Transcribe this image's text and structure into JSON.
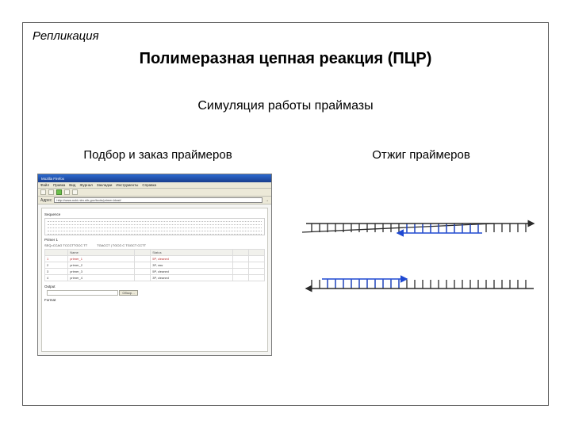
{
  "topic": "Репликация",
  "title": "Полимеразная цепная реакция (ПЦР)",
  "subtitle": "Симуляция работы праймазы",
  "captions": {
    "left": "Подбор и заказ праймеров",
    "right": "Отжиг праймеров"
  },
  "browser": {
    "window_title": "Mozilla Firefox",
    "menu": [
      "Файл",
      "Правка",
      "Вид",
      "Журнал",
      "Закладки",
      "Инструменты",
      "Справка"
    ],
    "address_label": "Адрес",
    "address_url": "http://www.ncbi.nlm.nih.gov/tools/primer-blast/",
    "go": "→"
  },
  "page": {
    "seq_section": "Sequence",
    "primer_section": "Primer 1",
    "primer_subinfo": {
      "col_a": "SEQ=CCAG TCCCTTGCC TT",
      "col_b": "TGACCT | TGCG C TGGCT CCTT"
    },
    "table": {
      "headers": [
        "",
        "Name",
        "",
        "Status",
        "",
        ""
      ],
      "rows": [
        [
          "1",
          "primer_1",
          "",
          "5P, cleaned",
          "",
          ""
        ],
        [
          "2",
          "primer_2",
          "",
          "3P, raw",
          "",
          ""
        ],
        [
          "3",
          "primer_3",
          "",
          "5P, cleaned",
          "",
          ""
        ],
        [
          "4",
          "primer_4",
          "",
          "3P, cleaned",
          "",
          ""
        ]
      ],
      "red_row_index": 0
    },
    "output_section": "Output",
    "output_button": "Обзор…",
    "format_section": "Format"
  },
  "diagram_colors": {
    "strand": "#2b2b2b",
    "primer": "#1f49d2"
  }
}
